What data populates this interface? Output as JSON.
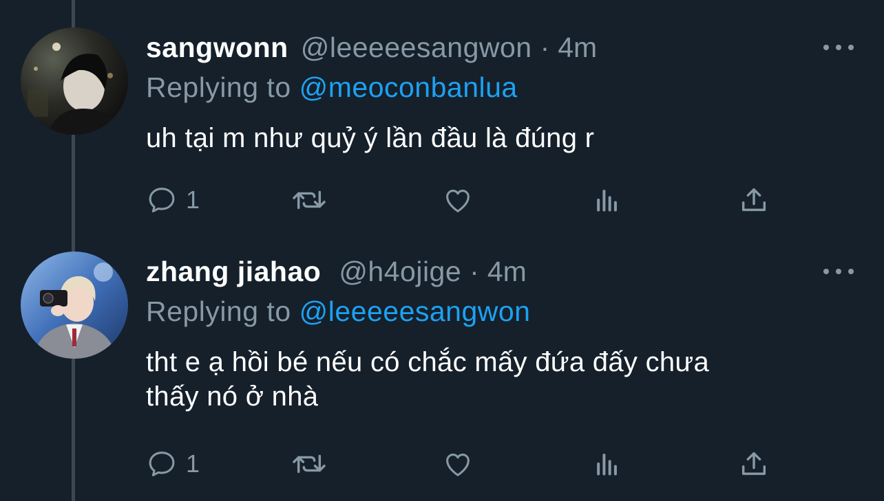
{
  "tweets": [
    {
      "name": "sangwonn",
      "handle": "@leeeeesangwon",
      "separator": "·",
      "time": "4m",
      "reply_prefix": "Replying to",
      "reply_to": "@meoconbanlua",
      "lines": [
        "uh tại m như quỷ ý lần đầu là đúng r"
      ],
      "reply_count": "1",
      "avatar": "dark-portrait-avatar"
    },
    {
      "name": "zhang jiahao",
      "handle": "@h4ojige",
      "separator": "·",
      "time": "4m",
      "reply_prefix": "Replying to",
      "reply_to": "@leeeeesangwon",
      "lines": [
        "tht e ạ hồi bé nếu có chắc mấy đứa đấy chưa",
        "thấy nó ở nhà"
      ],
      "reply_count": "1",
      "avatar": "blue-portrait-avatar"
    }
  ],
  "icons": [
    "more-icon",
    "reply-icon",
    "retweet-icon",
    "like-icon",
    "analytics-icon",
    "share-icon"
  ],
  "colors": {
    "background": "#15202b",
    "text": "#ffffff",
    "muted": "#8899a6",
    "link": "#1da1f2",
    "thread_line": "#3d4752"
  }
}
